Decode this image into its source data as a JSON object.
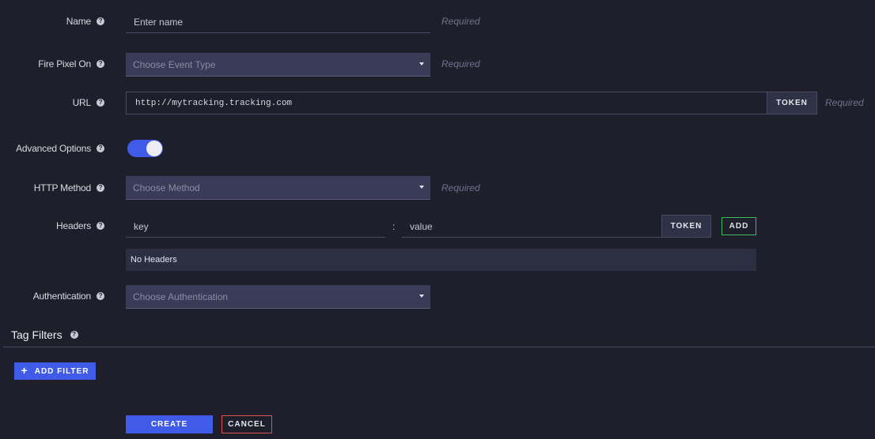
{
  "form": {
    "name": {
      "label": "Name",
      "placeholder": "Enter name",
      "required": "Required"
    },
    "fire_pixel": {
      "label": "Fire Pixel On",
      "placeholder": "Choose Event Type",
      "required": "Required"
    },
    "url": {
      "label": "URL",
      "value": "http://mytracking.tracking.com",
      "token_label": "TOKEN",
      "required": "Required"
    },
    "advanced": {
      "label": "Advanced Options",
      "enabled": true
    },
    "http_method": {
      "label": "HTTP Method",
      "placeholder": "Choose Method",
      "required": "Required"
    },
    "headers": {
      "label": "Headers",
      "key_placeholder": "key",
      "separator": ":",
      "value_placeholder": "value",
      "token_label": "TOKEN",
      "add_label": "ADD",
      "empty_text": "No Headers"
    },
    "authentication": {
      "label": "Authentication",
      "placeholder": "Choose Authentication"
    }
  },
  "tag_filters": {
    "title": "Tag Filters",
    "add_filter_label": "ADD FILTER",
    "add_filter_icon": "+"
  },
  "actions": {
    "create_label": "CREATE",
    "cancel_label": "CANCEL"
  },
  "help_icon_glyph": "?",
  "colors": {
    "background": "#1e1f2b",
    "accent": "#3f5be8",
    "add_border": "#3fb955",
    "cancel_border": "#d9534f"
  }
}
